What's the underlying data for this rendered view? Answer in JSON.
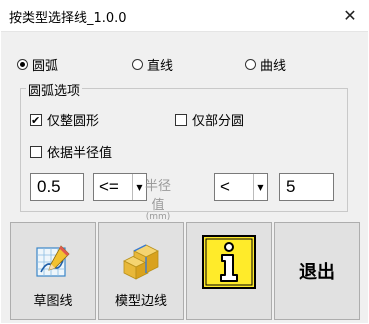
{
  "window": {
    "title": "按类型选择线_1.0.0",
    "close_icon": "close-icon"
  },
  "mode_radios": [
    {
      "label": "圆弧",
      "selected": true
    },
    {
      "label": "直线",
      "selected": false
    },
    {
      "label": "曲线",
      "selected": false
    }
  ],
  "arc_options": {
    "legend": "圆弧选项",
    "full_circle": {
      "label": "仅整圆形",
      "checked": true
    },
    "partial_circle": {
      "label": "仅部分圆",
      "checked": false
    },
    "by_radius": {
      "label": "依据半径值",
      "checked": false
    },
    "min_value": "0.5",
    "min_operator": "<=",
    "radius_label": "半径值",
    "radius_unit": "(mm)",
    "max_operator": "<",
    "max_value": "5"
  },
  "buttons": {
    "sketch": {
      "label": "草图线",
      "icon": "sketch-pencil-icon"
    },
    "model_edge": {
      "label": "模型边线",
      "icon": "model-block-icon"
    },
    "info": {
      "label": "",
      "icon": "info-icon"
    },
    "exit": {
      "label": "退出"
    }
  }
}
